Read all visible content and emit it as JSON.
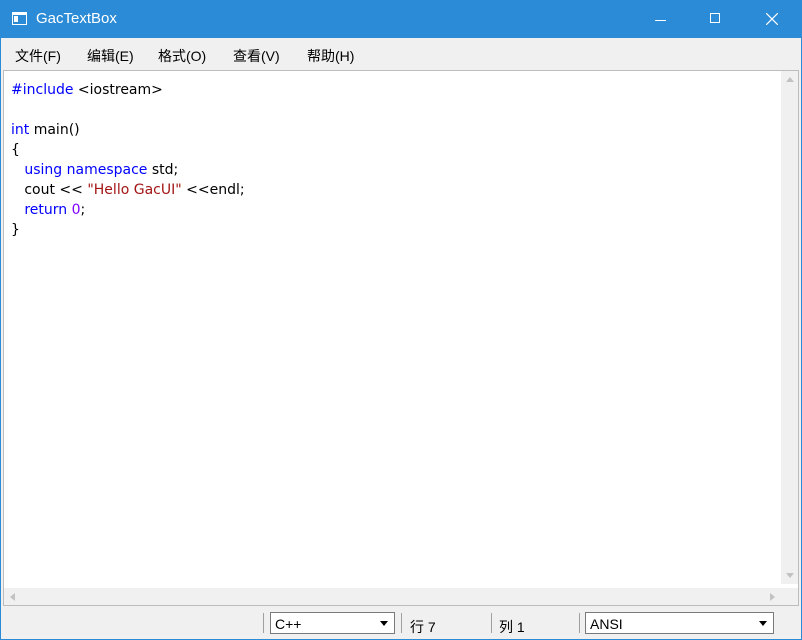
{
  "window": {
    "title": "GacTextBox"
  },
  "menu": {
    "items": [
      {
        "label": "文件(F)"
      },
      {
        "label": "编辑(E)"
      },
      {
        "label": "格式(O)"
      },
      {
        "label": "查看(V)"
      },
      {
        "label": "帮助(H)"
      }
    ]
  },
  "editor": {
    "lines": [
      [
        {
          "t": "#include",
          "c": "pp"
        },
        {
          "t": " <iostream>",
          "c": ""
        }
      ],
      [],
      [
        {
          "t": "int",
          "c": "kw"
        },
        {
          "t": " main()",
          "c": ""
        }
      ],
      [
        {
          "t": "{",
          "c": ""
        }
      ],
      [
        {
          "t": "   ",
          "c": ""
        },
        {
          "t": "using",
          "c": "kw"
        },
        {
          "t": " ",
          "c": ""
        },
        {
          "t": "namespace",
          "c": "kw"
        },
        {
          "t": " std;",
          "c": ""
        }
      ],
      [
        {
          "t": "   cout << ",
          "c": ""
        },
        {
          "t": "\"Hello GacUI\"",
          "c": "str"
        },
        {
          "t": " <<endl;",
          "c": ""
        }
      ],
      [
        {
          "t": "   ",
          "c": ""
        },
        {
          "t": "return",
          "c": "kw"
        },
        {
          "t": " ",
          "c": ""
        },
        {
          "t": "0",
          "c": "num"
        },
        {
          "t": ";",
          "c": ""
        }
      ],
      [
        {
          "t": "}",
          "c": ""
        }
      ]
    ],
    "colors": {
      "keyword": "#0000ff",
      "string": "#a31515",
      "number": "#8000ff"
    }
  },
  "status": {
    "language": "C++",
    "row_label": "行 7",
    "col_label": "列 1",
    "encoding": "ANSI"
  },
  "colors": {
    "titlebar": "#2b8bd6"
  }
}
